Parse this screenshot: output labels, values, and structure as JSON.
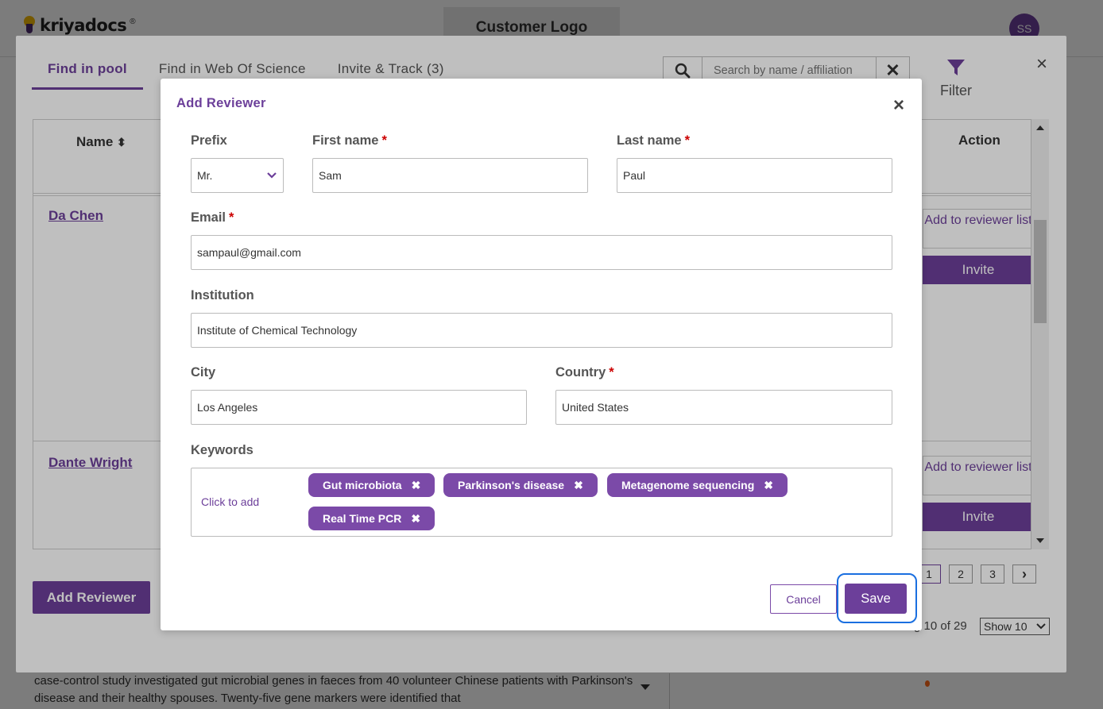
{
  "app": {
    "logo_text": "kriyadocs",
    "logo_reg": "®",
    "customer_logo": "Customer Logo",
    "avatar_initials": "SS",
    "bg_abstract": "case-control study investigated gut microbial genes in faeces from 40 volunteer Chinese patients with Parkinson's disease and their healthy spouses. Twenty-five gene markers were identified that"
  },
  "panel": {
    "tabs": [
      {
        "label": "Find in pool",
        "active": true
      },
      {
        "label": "Find in Web Of Science",
        "active": false
      },
      {
        "label": "Invite & Track (3)",
        "active": false
      }
    ],
    "search_placeholder": "Search by name / affiliation",
    "search_clear": "✕",
    "filter_label": "Filter",
    "close": "×",
    "columns": {
      "name": "Name",
      "name_sort": "⬍",
      "action": "Action"
    },
    "reviewers": [
      {
        "name": "Da Chen",
        "add_label": "Add to reviewer list",
        "invite_label": "Invite"
      },
      {
        "name": "Dante Wright",
        "add_label": "Add to reviewer list",
        "invite_label": "Invite"
      }
    ],
    "add_reviewer_label": "Add Reviewer",
    "pages": [
      "1",
      "2",
      "3"
    ],
    "next_page": "›",
    "showing_text": "g 10 of 29",
    "show_select": "Show 10"
  },
  "modal": {
    "title": "Add Reviewer",
    "close": "×",
    "prefix": {
      "label": "Prefix",
      "value": "Mr."
    },
    "first_name": {
      "label": "First name",
      "value": "Sam"
    },
    "last_name": {
      "label": "Last name",
      "value": "Paul"
    },
    "email": {
      "label": "Email",
      "value": "sampaul@gmail.com"
    },
    "institution": {
      "label": "Institution",
      "value": "Institute of Chemical Technology"
    },
    "city": {
      "label": "City",
      "value": "Los Angeles"
    },
    "country": {
      "label": "Country",
      "value": "United States"
    },
    "required_mark": "*",
    "keywords": {
      "label": "Keywords",
      "click_to_add": "Click to add",
      "items": [
        "Gut microbiota",
        "Parkinson's disease",
        "Metagenome sequencing",
        "Real Time PCR"
      ]
    },
    "remove_mark": "✖",
    "cancel_label": "Cancel",
    "save_label": "Save"
  },
  "colors": {
    "brand_purple": "#6c3f9a",
    "chip_purple": "#7b4aa8",
    "focus_ring": "#1a6fe0",
    "required": "#cc0000"
  }
}
